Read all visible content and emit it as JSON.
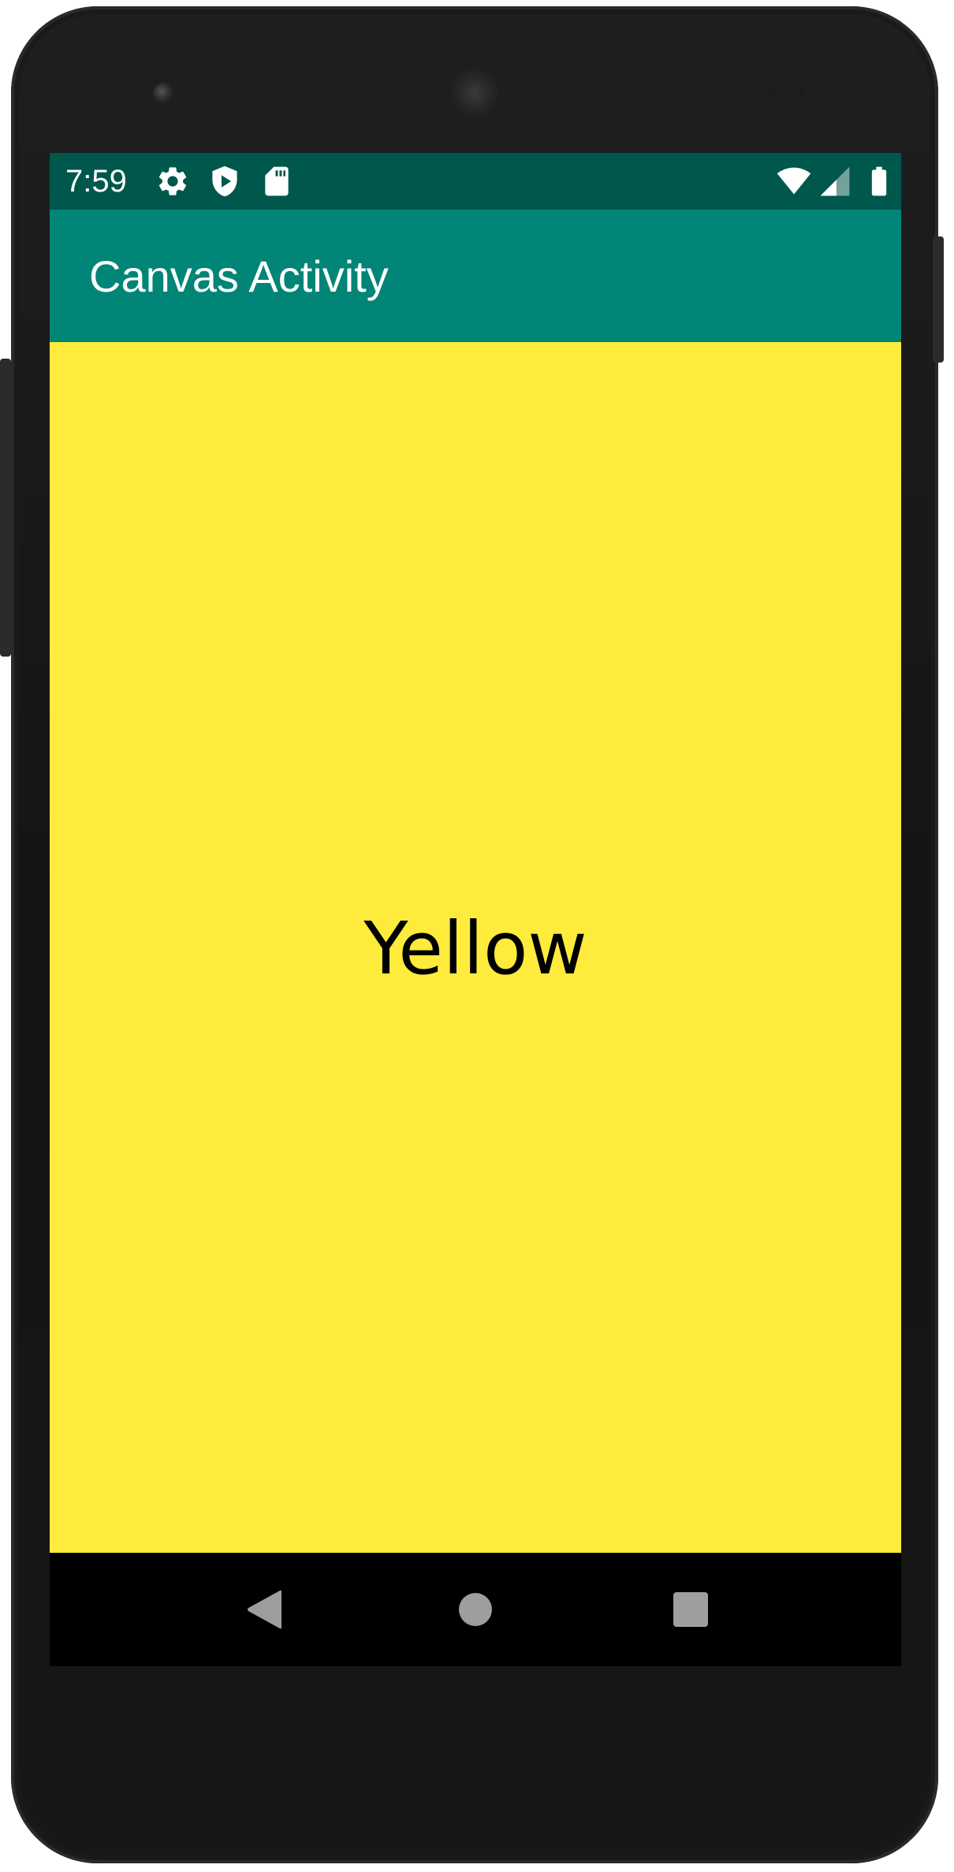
{
  "status_bar": {
    "time": "7:59",
    "left_icons": [
      "gear-icon",
      "shield-play-icon",
      "sd-card-icon"
    ],
    "right_icons": [
      "wifi-icon",
      "signal-icon",
      "battery-icon"
    ],
    "background": "#00574b"
  },
  "app_bar": {
    "title": "Canvas Activity",
    "background": "#008577"
  },
  "canvas": {
    "color_name": "Yellow",
    "background": "#ffeb3b"
  },
  "nav_bar": {
    "buttons": [
      "back-icon",
      "home-icon",
      "recents-icon"
    ]
  }
}
